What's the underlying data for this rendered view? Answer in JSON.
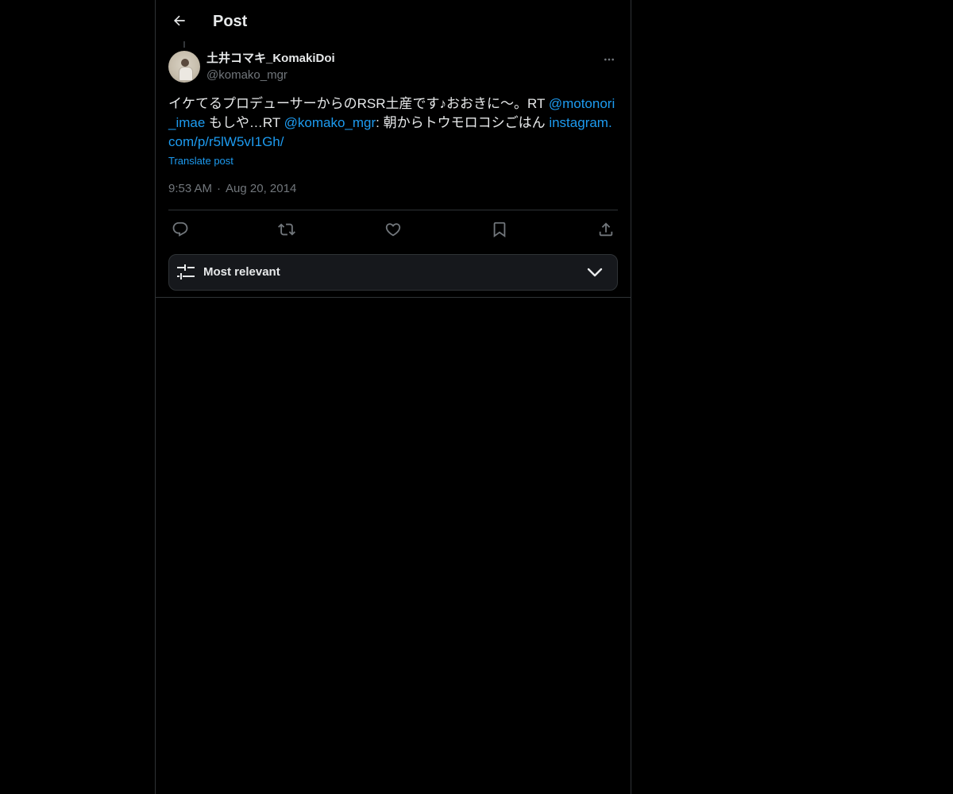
{
  "header": {
    "title": "Post",
    "back_icon": "arrow-left-icon"
  },
  "author": {
    "display_name": "土井コマキ_KomakiDoi",
    "handle": "@komako_mgr",
    "avatar_icon": "user-avatar-photo",
    "more_icon": "more-horizontal-icon"
  },
  "post": {
    "text_part1": "イケてるプロデューサーからのRSR土産です♪おおきに〜。RT ",
    "mention1": "@motonori_imae",
    "text_part2": " もしや…RT ",
    "mention2": "@komako_mgr",
    "text_part3": ": 朝からトウモロコシごはん ",
    "link": "instagram.com/p/r5lW5vI1Gh/",
    "translate_label": "Translate post",
    "time": "9:53 AM",
    "separator": "·",
    "date": "Aug 20, 2014"
  },
  "actions": [
    {
      "name": "reply",
      "icon": "reply-icon"
    },
    {
      "name": "repost",
      "icon": "repost-icon"
    },
    {
      "name": "like",
      "icon": "heart-icon"
    },
    {
      "name": "bookmark",
      "icon": "bookmark-icon"
    },
    {
      "name": "share",
      "icon": "share-icon"
    }
  ],
  "sort": {
    "label": "Most relevant",
    "icon": "tune-icon",
    "chevron_icon": "chevron-down-icon"
  },
  "colors": {
    "background": "#000000",
    "text": "#e7e9ea",
    "muted": "#71767b",
    "accent": "#1d9bf0",
    "border": "#2f3336"
  }
}
